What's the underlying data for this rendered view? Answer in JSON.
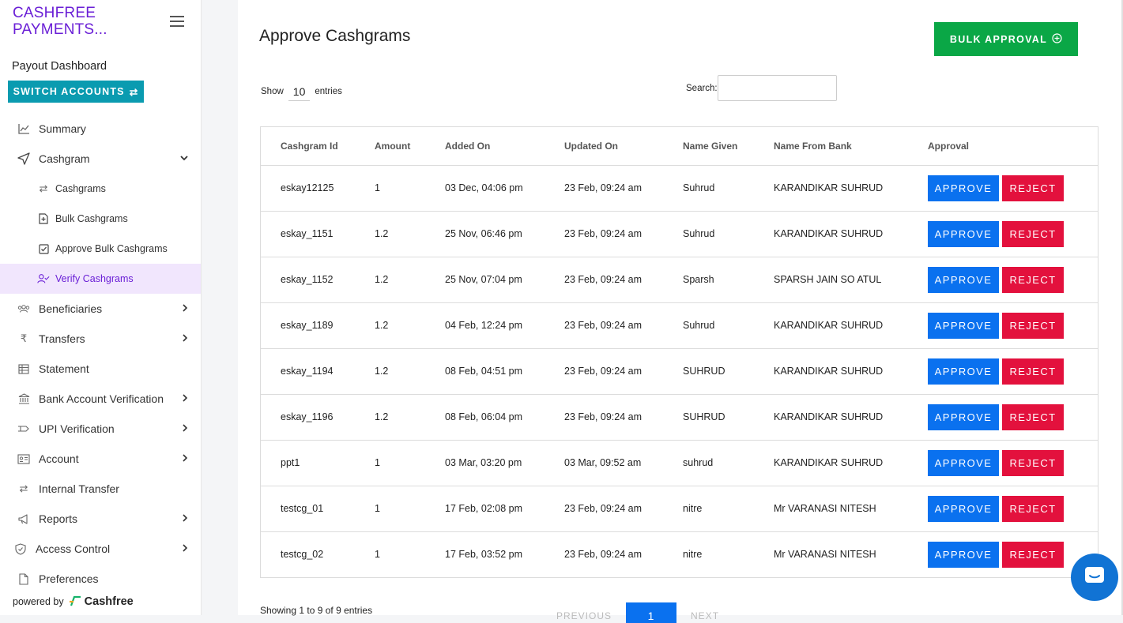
{
  "brand": {
    "name": "CASHFREE PAYMENTS..."
  },
  "sidebar": {
    "dashboard_title": "Payout Dashboard",
    "switch_label": "SWITCH ACCOUNTS",
    "items": [
      {
        "label": "Summary",
        "icon": "chart-line-icon"
      },
      {
        "label": "Cashgram",
        "icon": "send-icon"
      },
      {
        "label": "Cashgrams",
        "icon": "arrows-swap-icon"
      },
      {
        "label": "Bulk Cashgrams",
        "icon": "file-plus-icon"
      },
      {
        "label": "Approve Bulk Cashgrams",
        "icon": "checkbox-icon"
      },
      {
        "label": "Verify Cashgrams",
        "icon": "user-check-icon"
      },
      {
        "label": "Beneficiaries",
        "icon": "users-icon"
      },
      {
        "label": "Transfers",
        "icon": "rupee-icon"
      },
      {
        "label": "Statement",
        "icon": "table-icon"
      },
      {
        "label": "Bank Account Verification",
        "icon": "bank-icon"
      },
      {
        "label": "UPI Verification",
        "icon": "upi-icon"
      },
      {
        "label": "Account",
        "icon": "id-card-icon"
      },
      {
        "label": "Internal Transfer",
        "icon": "arrows-swap-icon"
      },
      {
        "label": "Reports",
        "icon": "megaphone-icon"
      },
      {
        "label": "Access Control",
        "icon": "shield-icon"
      },
      {
        "label": "Preferences",
        "icon": "document-icon"
      }
    ],
    "powered_by": "powered by",
    "powered_logo": "Cashfree"
  },
  "main": {
    "title": "Approve Cashgrams",
    "bulk_label": "BULK APPROVAL",
    "show_label": "Show",
    "entries_value": "10",
    "entries_label": "entries",
    "search_label": "Search:",
    "search_value": "",
    "columns": [
      "Cashgram Id",
      "Amount",
      "Added On",
      "Updated On",
      "Name Given",
      "Name From Bank",
      "Approval"
    ],
    "approve_label": "APPROVE",
    "reject_label": "REJECT",
    "rows": [
      [
        "eskay12125",
        "1",
        "03 Dec, 04:06 pm",
        "23 Feb, 09:24 am",
        "Suhrud",
        "KARANDIKAR SUHRUD"
      ],
      [
        "eskay_1151",
        "1.2",
        "25 Nov, 06:46 pm",
        "23 Feb, 09:24 am",
        "Suhrud",
        "KARANDIKAR SUHRUD"
      ],
      [
        "eskay_1152",
        "1.2",
        "25 Nov, 07:04 pm",
        "23 Feb, 09:24 am",
        "Sparsh",
        "SPARSH JAIN SO ATUL"
      ],
      [
        "eskay_1189",
        "1.2",
        "04 Feb, 12:24 pm",
        "23 Feb, 09:24 am",
        "Suhrud",
        "KARANDIKAR SUHRUD"
      ],
      [
        "eskay_1194",
        "1.2",
        "08 Feb, 04:51 pm",
        "23 Feb, 09:24 am",
        "SUHRUD",
        "KARANDIKAR SUHRUD"
      ],
      [
        "eskay_1196",
        "1.2",
        "08 Feb, 06:04 pm",
        "23 Feb, 09:24 am",
        "SUHRUD",
        "KARANDIKAR SUHRUD"
      ],
      [
        "ppt1",
        "1",
        "03 Mar, 03:20 pm",
        "03 Mar, 09:52 am",
        "suhrud",
        "KARANDIKAR SUHRUD"
      ],
      [
        "testcg_01",
        "1",
        "17 Feb, 02:08 pm",
        "23 Feb, 09:24 am",
        "nitre",
        "Mr VARANASI NITESH"
      ],
      [
        "testcg_02",
        "1",
        "17 Feb, 03:52 pm",
        "23 Feb, 09:24 am",
        "nitre",
        "Mr VARANASI NITESH"
      ]
    ],
    "info": "Showing 1 to 9 of 9 entries",
    "pager": {
      "prev": "PREVIOUS",
      "page": "1",
      "next": "NEXT"
    }
  },
  "colors": {
    "brand": "#6a1fd6",
    "switch": "#0a9bb0",
    "bulk": "#0aa746",
    "approve": "#0a71ef",
    "reject": "#e3113d",
    "active_bg": "#f1e6fd"
  }
}
